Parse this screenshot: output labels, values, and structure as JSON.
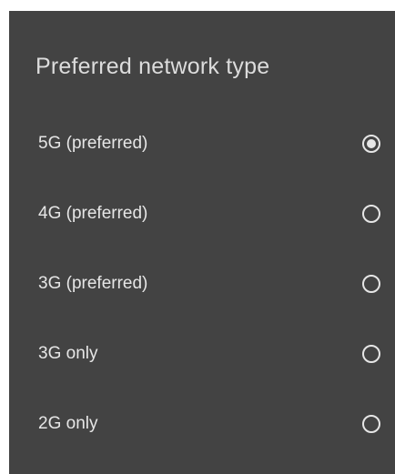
{
  "dialog": {
    "title": "Preferred network type",
    "options": [
      {
        "label": "5G (preferred)",
        "selected": true
      },
      {
        "label": "4G (preferred)",
        "selected": false
      },
      {
        "label": "3G (preferred)",
        "selected": false
      },
      {
        "label": "3G only",
        "selected": false
      },
      {
        "label": "2G only",
        "selected": false
      }
    ]
  },
  "colors": {
    "dialog_background": "#434343",
    "title_text": "#dcdcdc",
    "option_text": "#e6e6e6",
    "radio": "#e6e6e6"
  },
  "icons": {
    "radio_checked": "radio-checked-icon",
    "radio_unchecked": "radio-unchecked-icon"
  }
}
